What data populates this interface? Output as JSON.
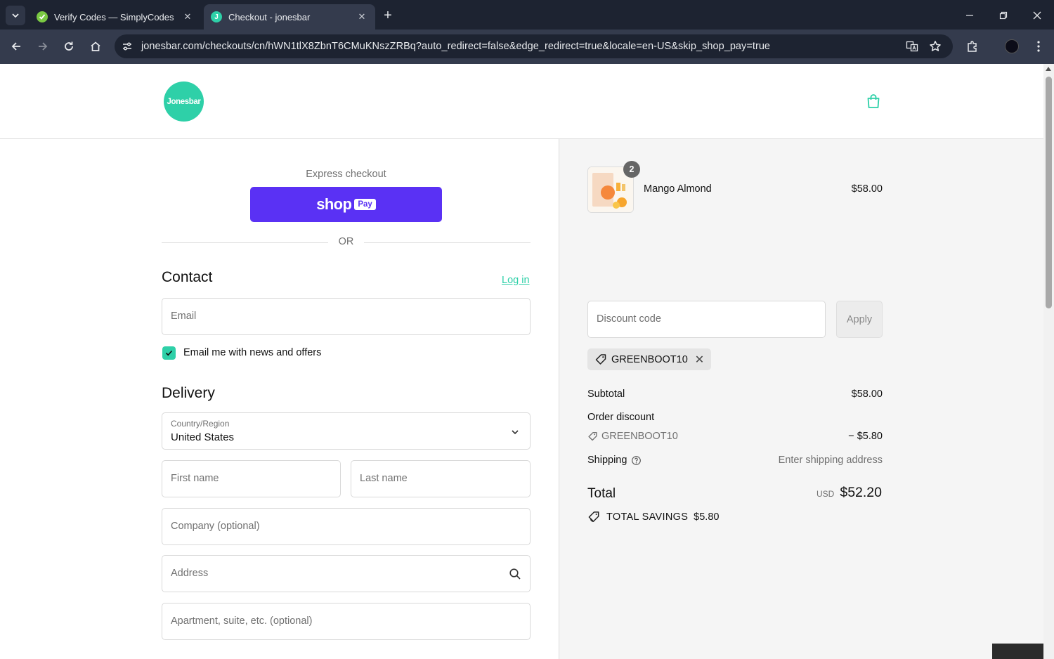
{
  "browser": {
    "tabs": [
      {
        "title": "Verify Codes — SimplyCodes",
        "favicon": "simplycodes-icon",
        "active": false
      },
      {
        "title": "Checkout - jonesbar",
        "favicon": "jonesbar-icon",
        "active": true
      }
    ],
    "url": "jonesbar.com/checkouts/cn/hWN1tlX8ZbnT6CMuKNszZRBq?auto_redirect=false&edge_redirect=true&locale=en-US&skip_shop_pay=true"
  },
  "header": {
    "logo_text": "Jonesbar",
    "brand_color": "#2ed0a8"
  },
  "checkout": {
    "express_label": "Express checkout",
    "shoppay": {
      "shop": "shop",
      "pay": "Pay",
      "color": "#5a31f4"
    },
    "or_label": "OR",
    "contact": {
      "title": "Contact",
      "login_label": "Log in",
      "email_placeholder": "Email",
      "newsletter_label": "Email me with news and offers",
      "newsletter_checked": true
    },
    "delivery": {
      "title": "Delivery",
      "country_label": "Country/Region",
      "country_value": "United States",
      "first_name_placeholder": "First name",
      "last_name_placeholder": "Last name",
      "company_placeholder": "Company (optional)",
      "address_placeholder": "Address",
      "apartment_placeholder": "Apartment, suite, etc. (optional)"
    }
  },
  "summary": {
    "product": {
      "name": "Mango Almond",
      "price": "$58.00",
      "quantity": "2"
    },
    "discount_placeholder": "Discount code",
    "apply_label": "Apply",
    "applied_code": "GREENBOOT10",
    "subtotal_label": "Subtotal",
    "subtotal_value": "$58.00",
    "order_discount_label": "Order discount",
    "discount_code": "GREENBOOT10",
    "discount_value": "− $5.80",
    "shipping_label": "Shipping",
    "shipping_value": "Enter shipping address",
    "total_label": "Total",
    "total_currency": "USD",
    "total_value": "$52.20",
    "savings_label": "TOTAL SAVINGS",
    "savings_value": "$5.80"
  }
}
